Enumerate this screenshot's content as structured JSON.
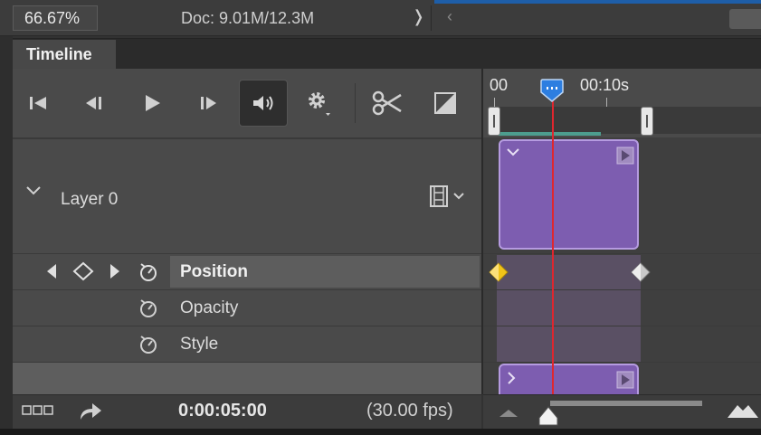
{
  "status_bar": {
    "zoom": "66.67%",
    "doc_info": "Doc: 9.01M/12.3M",
    "expand_arrow": "❭",
    "back_arrow": "‹"
  },
  "panel": {
    "tab_label": "Timeline"
  },
  "controls": [
    {
      "name": "go-to-first-frame",
      "icon": "skip-back-icon"
    },
    {
      "name": "previous-frame",
      "icon": "step-back-icon"
    },
    {
      "name": "play",
      "icon": "play-icon"
    },
    {
      "name": "next-frame",
      "icon": "step-forward-icon"
    },
    {
      "name": "audio",
      "icon": "speaker-icon"
    },
    {
      "name": "settings",
      "icon": "gear-icon"
    },
    {
      "name": "split-at-playhead",
      "icon": "scissors-icon"
    },
    {
      "name": "transition",
      "icon": "transition-icon"
    }
  ],
  "layers": [
    {
      "name": "Layer 0",
      "expanded": true
    }
  ],
  "properties": [
    {
      "label": "Position",
      "selected": true
    },
    {
      "label": "Opacity",
      "selected": false
    },
    {
      "label": "Style",
      "selected": false
    }
  ],
  "ruler": {
    "ticks": [
      "00",
      "00:10s"
    ]
  },
  "footer": {
    "timecode": "0:00:05:00",
    "fps": "(30.00 fps)"
  },
  "colors": {
    "clip": "#7d5db0",
    "playhead": "#e0262e",
    "keyframe_active": "#f0c419",
    "work_area": "#4d9d8e",
    "playhead_head": "#2d7ee0"
  }
}
